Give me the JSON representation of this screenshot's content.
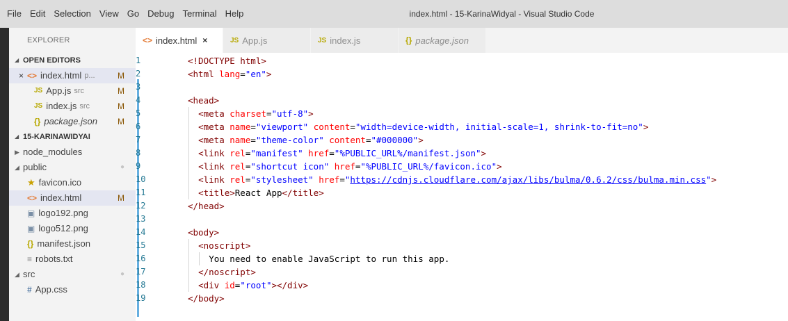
{
  "menu": [
    "File",
    "Edit",
    "Selection",
    "View",
    "Go",
    "Debug",
    "Terminal",
    "Help"
  ],
  "window_title": "index.html - 15-KarinaWidyal - Visual Studio Code",
  "sidebar": {
    "title": "EXPLORER",
    "open_editors_label": "OPEN EDITORS",
    "open_editors": [
      {
        "name": "index.html",
        "desc": "p...",
        "status": "M",
        "icon": "html-icon",
        "active": true
      },
      {
        "name": "App.js",
        "desc": "src",
        "status": "M",
        "icon": "js-icon"
      },
      {
        "name": "index.js",
        "desc": "src",
        "status": "M",
        "icon": "js-icon"
      },
      {
        "name": "package.json",
        "desc": "",
        "status": "M",
        "icon": "json-icon"
      }
    ],
    "project_label": "15-KARINAWIDYAI",
    "tree": [
      {
        "name": "node_modules",
        "type": "folder-collapsed",
        "depth": 0
      },
      {
        "name": "public",
        "type": "folder-open",
        "depth": 0,
        "status": "●"
      },
      {
        "name": "favicon.ico",
        "type": "star-icon",
        "depth": 1
      },
      {
        "name": "index.html",
        "type": "html-icon",
        "depth": 1,
        "status": "M",
        "selected": true
      },
      {
        "name": "logo192.png",
        "type": "image-icon",
        "depth": 1
      },
      {
        "name": "logo512.png",
        "type": "image-icon",
        "depth": 1
      },
      {
        "name": "manifest.json",
        "type": "json-icon",
        "depth": 1
      },
      {
        "name": "robots.txt",
        "type": "text-icon",
        "depth": 1
      },
      {
        "name": "src",
        "type": "folder-open",
        "depth": 0,
        "status": "●"
      },
      {
        "name": "App.css",
        "type": "css-icon",
        "depth": 1
      }
    ]
  },
  "tabs": [
    {
      "label": "index.html",
      "icon": "<>",
      "active": true,
      "close": "×"
    },
    {
      "label": "App.js",
      "icon": "JS"
    },
    {
      "label": "index.js",
      "icon": "JS"
    },
    {
      "label": "package.json",
      "icon": "{}",
      "italic": true
    }
  ],
  "editor": {
    "lines": [
      {
        "n": "1",
        "indent": 0,
        "tokens": [
          [
            "t-tag",
            "<!DOCTYPE html>"
          ]
        ]
      },
      {
        "n": "2",
        "indent": 0,
        "tokens": [
          [
            "t-tag",
            "<html "
          ],
          [
            "t-attr",
            "lang"
          ],
          [
            "t-text",
            "="
          ],
          [
            "t-val",
            "\"en\""
          ],
          [
            "t-tag",
            ">"
          ]
        ]
      },
      {
        "n": "3",
        "indent": 0,
        "tokens": []
      },
      {
        "n": "4",
        "indent": 0,
        "tokens": [
          [
            "t-tag",
            "<head>"
          ]
        ]
      },
      {
        "n": "5",
        "indent": 1,
        "tokens": [
          [
            "t-tag",
            "<meta "
          ],
          [
            "t-attr",
            "charset"
          ],
          [
            "t-text",
            "="
          ],
          [
            "t-val",
            "\"utf-8\""
          ],
          [
            "t-tag",
            ">"
          ]
        ]
      },
      {
        "n": "6",
        "indent": 1,
        "tokens": [
          [
            "t-tag",
            "<meta "
          ],
          [
            "t-attr",
            "name"
          ],
          [
            "t-text",
            "="
          ],
          [
            "t-val",
            "\"viewport\" "
          ],
          [
            "t-attr",
            "content"
          ],
          [
            "t-text",
            "="
          ],
          [
            "t-val",
            "\"width=device-width, initial-scale=1, shrink-to-fit=no\""
          ],
          [
            "t-tag",
            ">"
          ]
        ]
      },
      {
        "n": "7",
        "indent": 1,
        "tokens": [
          [
            "t-tag",
            "<meta "
          ],
          [
            "t-attr",
            "name"
          ],
          [
            "t-text",
            "="
          ],
          [
            "t-val",
            "\"theme-color\" "
          ],
          [
            "t-attr",
            "content"
          ],
          [
            "t-text",
            "="
          ],
          [
            "t-val",
            "\"#000000\""
          ],
          [
            "t-tag",
            ">"
          ]
        ]
      },
      {
        "n": "8",
        "indent": 1,
        "tokens": [
          [
            "t-tag",
            "<link "
          ],
          [
            "t-attr",
            "rel"
          ],
          [
            "t-text",
            "="
          ],
          [
            "t-val",
            "\"manifest\" "
          ],
          [
            "t-attr",
            "href"
          ],
          [
            "t-text",
            "="
          ],
          [
            "t-val",
            "\"%PUBLIC_URL%/manifest.json\""
          ],
          [
            "t-tag",
            ">"
          ]
        ]
      },
      {
        "n": "9",
        "indent": 1,
        "tokens": [
          [
            "t-tag",
            "<link "
          ],
          [
            "t-attr",
            "rel"
          ],
          [
            "t-text",
            "="
          ],
          [
            "t-val",
            "\"shortcut icon\" "
          ],
          [
            "t-attr",
            "href"
          ],
          [
            "t-text",
            "="
          ],
          [
            "t-val",
            "\"%PUBLIC_URL%/favicon.ico\""
          ],
          [
            "t-tag",
            ">"
          ]
        ]
      },
      {
        "n": "10",
        "indent": 1,
        "tokens": [
          [
            "t-tag",
            "<link "
          ],
          [
            "t-attr",
            "rel"
          ],
          [
            "t-text",
            "="
          ],
          [
            "t-val",
            "\"stylesheet\" "
          ],
          [
            "t-attr",
            "href"
          ],
          [
            "t-text",
            "="
          ],
          [
            "t-val",
            "\""
          ],
          [
            "t-link",
            "https://cdnjs.cloudflare.com/ajax/libs/bulma/0.6.2/css/bulma.min.css"
          ],
          [
            "t-val",
            "\""
          ],
          [
            "t-tag",
            ">"
          ]
        ]
      },
      {
        "n": "11",
        "indent": 1,
        "tokens": [
          [
            "t-tag",
            "<title>"
          ],
          [
            "t-text",
            "React App"
          ],
          [
            "t-tag",
            "</title>"
          ]
        ]
      },
      {
        "n": "12",
        "indent": 0,
        "tokens": [
          [
            "t-tag",
            "</head>"
          ]
        ]
      },
      {
        "n": "13",
        "indent": 0,
        "tokens": []
      },
      {
        "n": "14",
        "indent": 0,
        "tokens": [
          [
            "t-tag",
            "<body>"
          ]
        ]
      },
      {
        "n": "15",
        "indent": 1,
        "tokens": [
          [
            "t-tag",
            "<noscript>"
          ]
        ]
      },
      {
        "n": "16",
        "indent": 2,
        "tokens": [
          [
            "t-text",
            "You need to enable JavaScript to run this app."
          ]
        ]
      },
      {
        "n": "17",
        "indent": 1,
        "tokens": [
          [
            "t-tag",
            "</noscript>"
          ]
        ]
      },
      {
        "n": "18",
        "indent": 1,
        "tokens": [
          [
            "t-tag",
            "<div "
          ],
          [
            "t-attr",
            "id"
          ],
          [
            "t-text",
            "="
          ],
          [
            "t-val",
            "\"root\""
          ],
          [
            "t-tag",
            "></div>"
          ]
        ]
      },
      {
        "n": "19",
        "indent": 0,
        "tokens": [
          [
            "t-tag",
            "</body>"
          ]
        ]
      }
    ]
  },
  "colors": {
    "activity_bar": "#2c2c2c",
    "sidebar_bg": "#f3f3f3",
    "modified": "#895503",
    "tag": "#800000",
    "attribute": "#ff0000",
    "value": "#0000ff",
    "line_number": "#237893"
  }
}
